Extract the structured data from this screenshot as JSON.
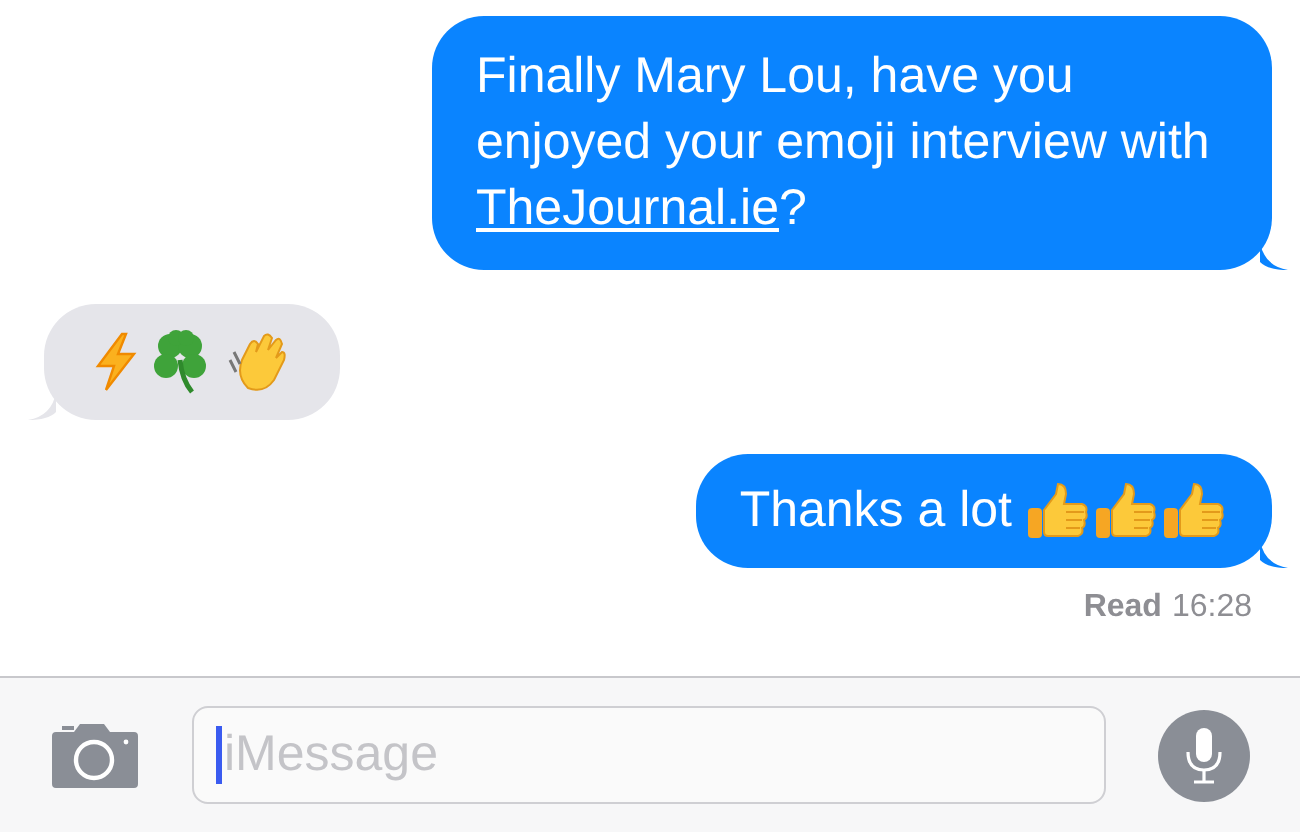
{
  "messages": [
    {
      "kind": "sent",
      "parts": [
        {
          "kind": "text",
          "text": "Finally Mary Lou, have you enjoyed your emoji interview with "
        },
        {
          "kind": "link",
          "text": "TheJournal.ie"
        },
        {
          "kind": "text",
          "text": "?"
        }
      ]
    },
    {
      "kind": "received",
      "parts": [
        {
          "kind": "lightning"
        },
        {
          "kind": "clover"
        },
        {
          "kind": "wave"
        }
      ]
    },
    {
      "kind": "sent",
      "parts": [
        {
          "kind": "text",
          "text": "Thanks a lot "
        },
        {
          "kind": "thumbs"
        },
        {
          "kind": "thumbs"
        },
        {
          "kind": "thumbs"
        }
      ]
    }
  ],
  "receipt": {
    "status": "Read",
    "time": "16:28"
  },
  "composer": {
    "placeholder": "iMessage"
  }
}
